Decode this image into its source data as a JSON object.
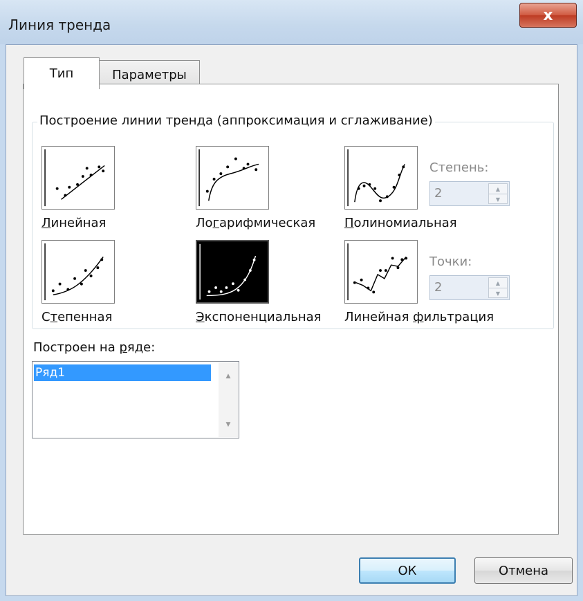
{
  "window": {
    "title": "Линия тренда",
    "close_glyph": "x"
  },
  "tabs": [
    {
      "label": "Тип",
      "selected": true
    },
    {
      "label": "Параметры",
      "selected": false
    }
  ],
  "trend_group": {
    "label": "Построение линии тренда (аппроксимация и сглаживание)",
    "types": [
      {
        "id": "linear",
        "pre": "",
        "mnemonic": "Л",
        "post": "инейная",
        "icon": "linear-trend-icon"
      },
      {
        "id": "log",
        "pre": "Ло",
        "mnemonic": "г",
        "post": "арифмическая",
        "icon": "logarithmic-trend-icon"
      },
      {
        "id": "poly",
        "pre": "",
        "mnemonic": "П",
        "post": "олиномиальная",
        "icon": "polynomial-trend-icon"
      },
      {
        "id": "power",
        "pre": "С",
        "mnemonic": "т",
        "post": "епенная",
        "icon": "power-trend-icon"
      },
      {
        "id": "exp",
        "pre": "",
        "mnemonic": "Э",
        "post": "кспоненциальная",
        "icon": "exponential-trend-icon",
        "selected": true
      },
      {
        "id": "movavg",
        "pre": "Линейная ",
        "mnemonic": "ф",
        "post": "ильтрация",
        "icon": "moving-average-trend-icon"
      }
    ],
    "degree": {
      "label": "Степень:",
      "value": "2"
    },
    "period": {
      "label": "Точки:",
      "value": "2"
    }
  },
  "series": {
    "label_pre": "Построен на ",
    "label_mnemonic": "р",
    "label_post": "яде:",
    "items": [
      "Ряд1"
    ]
  },
  "buttons": {
    "ok": "ОК",
    "cancel": "Отмена"
  },
  "colors": {
    "selection": "#3399ff",
    "title_bar": "#c6d9ee",
    "close_button": "#c9472f"
  }
}
